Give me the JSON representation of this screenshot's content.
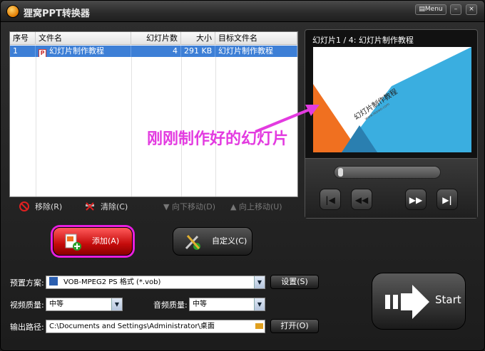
{
  "window": {
    "title": "狸窝PPT转换器",
    "menu_label": "▤Menu",
    "minimize": "–",
    "close": "×"
  },
  "list": {
    "headers": [
      "序号",
      "文件名",
      "幻灯片数",
      "大小",
      "目标文件名"
    ],
    "rows": [
      {
        "index": "1",
        "filename": "幻灯片制作教程",
        "slides": "4",
        "size": "291 KB",
        "target": "幻灯片制作教程"
      }
    ]
  },
  "actions": {
    "remove": "移除(R)",
    "clear": "清除(C)",
    "move_down": "向下移动(D)",
    "move_up": "向上移动(U)"
  },
  "preview": {
    "title": "幻灯片1 / 4: 幻灯片制作教程",
    "slide_text": "幻灯片制作教程",
    "slide_sub": "www.leawo.com"
  },
  "annotation": "刚刚制作好的幻灯片",
  "buttons": {
    "add": "添加(A)",
    "custom": "自定义(C)",
    "settings": "设置(S)",
    "open": "打开(O)",
    "start": "Start"
  },
  "form": {
    "preset_label": "预置方案:",
    "preset_value": "VOB-MPEG2 PS 格式 (*.vob)",
    "video_label": "视频质量:",
    "video_value": "中等",
    "audio_label": "音频质量:",
    "audio_value": "中等",
    "output_label": "输出路径:",
    "output_value": "C:\\Documents and Settings\\Administrator\\桌面"
  },
  "colors": {
    "selected_row": "#3d7fd6",
    "add_button": "#c50b0b",
    "annotation": "#e33be0",
    "slide_orange": "#f07020",
    "slide_blue": "#3aaee0"
  }
}
